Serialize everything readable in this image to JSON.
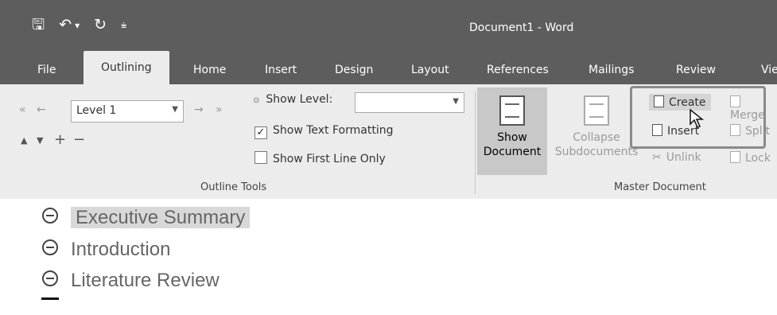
{
  "window": {
    "title": "Document1 - Word"
  },
  "qat": {
    "save": "🖫",
    "undo": "↶",
    "undo_dd": "▾",
    "redo": "↻",
    "customize": "⩧"
  },
  "tabs": [
    "File",
    "Outlining",
    "Home",
    "Insert",
    "Design",
    "Layout",
    "References",
    "Mailings",
    "Review",
    "View"
  ],
  "outline_tools": {
    "promote_to_heading": "«",
    "promote": "←",
    "level_value": "Level 1",
    "demote": "→",
    "demote_to_body": "»",
    "move_up": "▲",
    "move_down": "▼",
    "expand": "+",
    "collapse": "−",
    "show_level_label": "Show Level:",
    "show_text_formatting": "Show Text Formatting",
    "show_first_line_only": "Show First Line Only",
    "check": "✓",
    "group_label": "Outline Tools"
  },
  "master_document": {
    "show_document": [
      "Show",
      "Document"
    ],
    "collapse_subdocuments": [
      "Collapse",
      "Subdocuments"
    ],
    "create": "Create",
    "insert": "Insert",
    "unlink": "Unlink",
    "merge": "Merge",
    "split": "Split",
    "lock": "Lock",
    "group_label": "Master Document"
  },
  "document": {
    "headings": [
      "Executive Summary",
      "Introduction",
      "Literature Review"
    ]
  }
}
